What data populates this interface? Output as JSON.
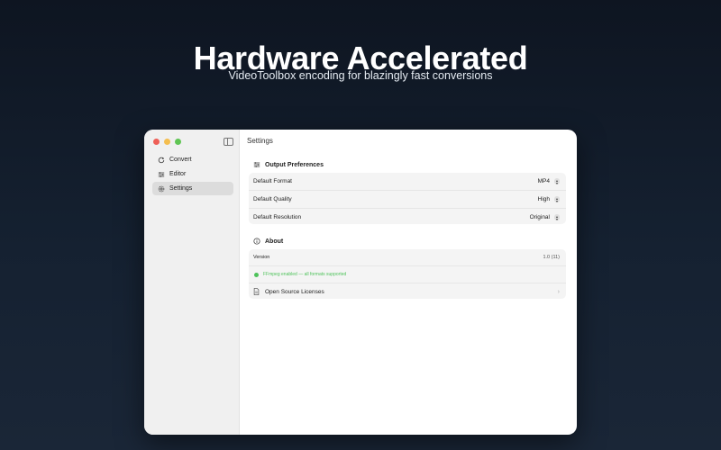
{
  "hero": {
    "title": "Hardware Accelerated",
    "subtitle": "VideoToolbox encoding for blazingly fast conversions"
  },
  "sidebar": {
    "items": [
      {
        "label": "Convert",
        "icon": "refresh-icon",
        "active": false
      },
      {
        "label": "Editor",
        "icon": "sliders-icon",
        "active": false
      },
      {
        "label": "Settings",
        "icon": "gear-icon",
        "active": true
      }
    ]
  },
  "main": {
    "title": "Settings",
    "output_preferences": {
      "header": "Output Preferences",
      "rows": [
        {
          "label": "Default Format",
          "value": "MP4"
        },
        {
          "label": "Default Quality",
          "value": "High"
        },
        {
          "label": "Default Resolution",
          "value": "Original"
        }
      ]
    },
    "about": {
      "header": "About",
      "version_label": "Version",
      "version_value": "1.0 (11)",
      "ffmpeg_status": "FFmpeg enabled — all formats supported",
      "licenses_label": "Open Source Licenses"
    }
  },
  "colors": {
    "status_green": "#4ec25a",
    "traffic_red": "#ee5f57",
    "traffic_yellow": "#f4be4f",
    "traffic_green": "#60c554"
  }
}
